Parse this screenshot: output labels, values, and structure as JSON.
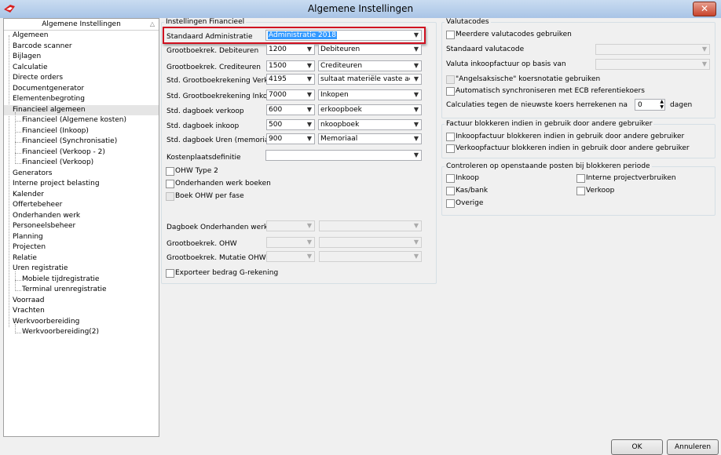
{
  "window": {
    "title": "Algemene Instellingen"
  },
  "tree": {
    "header": "Algemene Instellingen",
    "items": [
      {
        "label": "Algemeen",
        "level": 0
      },
      {
        "label": "Barcode scanner",
        "level": 0
      },
      {
        "label": "Bijlagen",
        "level": 0
      },
      {
        "label": "Calculatie",
        "level": 0
      },
      {
        "label": "Directe orders",
        "level": 0
      },
      {
        "label": "Documentgenerator",
        "level": 0
      },
      {
        "label": "Elementenbegroting",
        "level": 0
      },
      {
        "label": "Financieel algemeen",
        "level": 0,
        "selected": true
      },
      {
        "label": "Financieel (Algemene kosten)",
        "level": 1
      },
      {
        "label": "Financieel (Inkoop)",
        "level": 1
      },
      {
        "label": "Financieel (Synchronisatie)",
        "level": 1
      },
      {
        "label": "Financieel (Verkoop - 2)",
        "level": 1
      },
      {
        "label": "Financieel (Verkoop)",
        "level": 1
      },
      {
        "label": "Generators",
        "level": 0
      },
      {
        "label": "Interne project belasting",
        "level": 0
      },
      {
        "label": "Kalender",
        "level": 0
      },
      {
        "label": "Offertebeheer",
        "level": 0
      },
      {
        "label": "Onderhanden werk",
        "level": 0
      },
      {
        "label": "Personeelsbeheer",
        "level": 0
      },
      {
        "label": "Planning",
        "level": 0
      },
      {
        "label": "Projecten",
        "level": 0
      },
      {
        "label": "Relatie",
        "level": 0
      },
      {
        "label": "Uren registratie",
        "level": 0
      },
      {
        "label": "Mobiele tijdregistratie",
        "level": 1
      },
      {
        "label": "Terminal urenregistratie",
        "level": 1
      },
      {
        "label": "Voorraad",
        "level": 0
      },
      {
        "label": "Vrachten",
        "level": 0
      },
      {
        "label": "Werkvoorbereiding",
        "level": 0
      },
      {
        "label": "Werkvoorbereiding(2)",
        "level": 1
      }
    ]
  },
  "financieel": {
    "group_label": "Instellingen Financieel",
    "std_admin_label": "Standaard Administratie",
    "std_admin_value": "Administratie 2018",
    "rows": [
      {
        "label": "Grootboekrek. Debiteuren",
        "code": "1200",
        "name": "Debiteuren"
      },
      {
        "label": "Grootboekrek. Crediteuren",
        "code": "1500",
        "name": "Crediteuren"
      },
      {
        "label": "Std. Grootboekrekening Verkoop",
        "code": "4195",
        "name": "sultaat materiële vaste activa"
      },
      {
        "label": "Std. Grootboekrekening Inkoop",
        "code": "7000",
        "name": "Inkopen"
      },
      {
        "label": "Std. dagboek verkoop",
        "code": "600",
        "name": "erkoopboek"
      },
      {
        "label": "Std. dagboek inkoop",
        "code": "500",
        "name": "nkoopboek"
      },
      {
        "label": "Std. dagboek Uren (memoriaal)",
        "code": "900",
        "name": "Memoriaal"
      }
    ],
    "kostenplaats_label": "Kostenplaatsdefinitie",
    "kostenplaats_value": "",
    "ohw_type2": "OHW Type 2",
    "onderhanden_boeken": "Onderhanden werk boeken",
    "boek_ohw_fase": "Boek OHW per fase",
    "dagboek_ohw": "Dagboek Onderhanden werk",
    "gb_ohw": "Grootboekrek. OHW",
    "gb_mutatie_ohw": "Grootboekrek. Mutatie OHW",
    "exporteer_g": "Exporteer bedrag G-rekening"
  },
  "valuta": {
    "group_label": "Valutacodes",
    "meerdere": "Meerdere valutacodes gebruiken",
    "standaard_label": "Standaard valutacode",
    "inkoop_label": "Valuta inkoopfactuur op basis van",
    "angelsaksisch": "\"Angelsaksische\" koersnotatie gebruiken",
    "ecb": "Automatisch synchroniseren met ECB referentiekoers",
    "herrekenen_label": "Calculaties tegen de nieuwste koers herrekenen na",
    "herrekenen_value": "0",
    "dagen": "dagen"
  },
  "factuur_blok": {
    "group_label": "Factuur blokkeren indien in gebruik door andere gebruiker",
    "inkoop": "Inkoopfactuur blokkeren indien in gebruik door andere gebruiker",
    "verkoop": "Verkoopfactuur blokkeren indien in gebruik door andere gebruiker"
  },
  "open_posten": {
    "group_label": "Controleren op openstaande posten bij blokkeren periode",
    "inkoop": "Inkoop",
    "interne": "Interne projectverbruiken",
    "kasbank": "Kas/bank",
    "verkoop": "Verkoop",
    "overige": "Overige"
  },
  "buttons": {
    "ok": "OK",
    "cancel": "Annuleren"
  }
}
